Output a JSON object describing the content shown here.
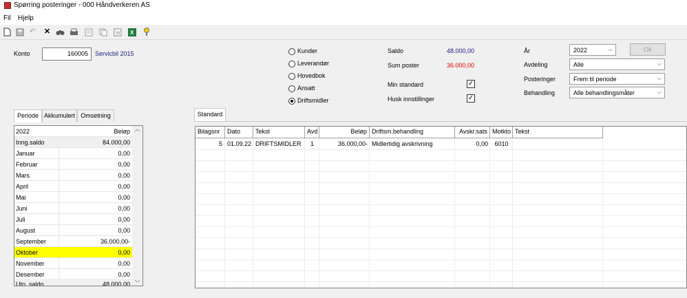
{
  "window": {
    "title": "Spørring posteringer - 000 Håndverkeren AS"
  },
  "menu": {
    "file": "Fil",
    "help": "Hjelp"
  },
  "toolbar": {
    "icons": [
      "new-file-icon",
      "save-icon",
      "undo-icon",
      "delete-icon",
      "find-icon",
      "print-icon",
      "preview-icon",
      "copy-icon",
      "word-icon",
      "excel-icon",
      "help-icon"
    ]
  },
  "konto": {
    "label": "Konto",
    "value": "160005",
    "name": "Servicbil 2015"
  },
  "radio": {
    "options": [
      "Kunder",
      "Leverandør",
      "Hovedbok",
      "Ansatt",
      "Driftsmidler"
    ],
    "selected": "Driftsmidler"
  },
  "summary": {
    "saldo_label": "Saldo",
    "saldo_value": "48.000,00",
    "sum_label": "Sum poster",
    "sum_value": "36.000,00",
    "min_standard_label": "Min standard",
    "min_standard_checked": true,
    "husk_label": "Husk innstillinger",
    "husk_checked": true,
    "saldo_color": "#1a1a80",
    "sum_color": "#e00000"
  },
  "filters": {
    "ar_label": "År",
    "ar_value": "2022",
    "ok_label": "Ok",
    "avdeling_label": "Avdeling",
    "avdeling_value": "Alle",
    "posteringer_label": "Posteringer",
    "posteringer_value": "Frem til periode",
    "behandling_label": "Behandling",
    "behandling_value": "Alle behandlingsmåter"
  },
  "left_tabs": [
    "Periode",
    "Akkumulert",
    "Omsetning"
  ],
  "left_grid": {
    "header": [
      "2022",
      "Beløp"
    ],
    "rows": [
      [
        "Inng.saldo",
        "84.000,00"
      ],
      [
        "Januar",
        "0,00"
      ],
      [
        "Februar",
        "0,00"
      ],
      [
        "Mars",
        "0,00"
      ],
      [
        "April",
        "0,00"
      ],
      [
        "Mai",
        "0,00"
      ],
      [
        "Juni",
        "0,00"
      ],
      [
        "Juli",
        "0,00"
      ],
      [
        "August",
        "0,00"
      ],
      [
        "September",
        "36.000,00-"
      ],
      [
        "Oktober",
        "0,00"
      ],
      [
        "November",
        "0,00"
      ],
      [
        "Desember",
        "0,00"
      ],
      [
        "Uto. saldo",
        "48.000,00"
      ]
    ],
    "highlight_color": "#ffff00"
  },
  "right_tab": "Standard",
  "right_grid": {
    "headers": [
      "Bilagsnr",
      "Dato",
      "Tekst",
      "Avd",
      "Beløp",
      "Driftsm.behandling",
      "Avskr.sats",
      "Motkto",
      "Tekst"
    ],
    "rows": [
      [
        "5",
        "01.09.22",
        "DRIFTSMIDLER",
        "1",
        "36.000,00-",
        "Midlertidig avskrivning",
        "0,00",
        "6010",
        ""
      ]
    ]
  }
}
